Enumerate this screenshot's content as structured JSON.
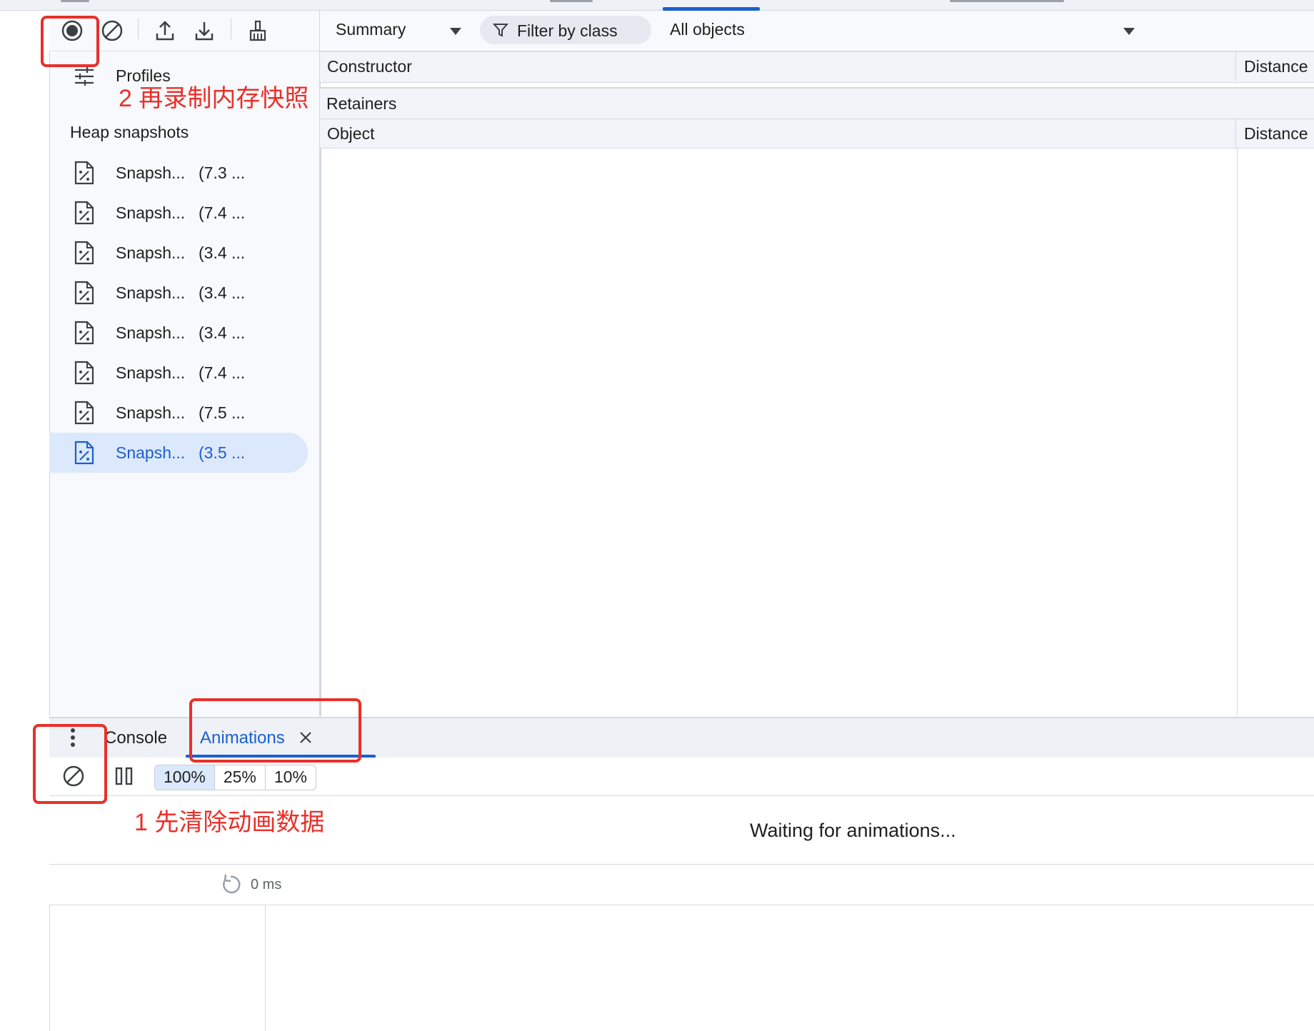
{
  "left_toolbar": {
    "record_icon": "record-icon",
    "clear_icon": "clear-icon",
    "load_icon": "upload-icon",
    "save_icon": "download-icon",
    "gc_icon": "broom-icon"
  },
  "sidebar": {
    "profiles_label": "Profiles",
    "heap_snapshots_title": "Heap snapshots",
    "snapshots": [
      {
        "name": "Snapsh...",
        "size": "(7.3 ..."
      },
      {
        "name": "Snapsh...",
        "size": "(7.4 ..."
      },
      {
        "name": "Snapsh...",
        "size": "(3.4 ..."
      },
      {
        "name": "Snapsh...",
        "size": "(3.4 ..."
      },
      {
        "name": "Snapsh...",
        "size": "(3.4 ..."
      },
      {
        "name": "Snapsh...",
        "size": "(7.4 ..."
      },
      {
        "name": "Snapsh...",
        "size": "(7.5 ..."
      },
      {
        "name": "Snapsh...",
        "size": "(3.5 ...",
        "selected": true
      }
    ]
  },
  "main_toolbar": {
    "view_select": "Summary",
    "filter_placeholder": "Filter by class",
    "objects_select": "All objects"
  },
  "constructor_grid": {
    "col_constructor": "Constructor",
    "col_distance": "Distance"
  },
  "retainers": {
    "title": "Retainers",
    "col_object": "Object",
    "col_distance": "Distance"
  },
  "drawer": {
    "tabs": [
      {
        "label": "Console"
      },
      {
        "label": "Animations",
        "active": true
      }
    ],
    "speeds": [
      "100%",
      "25%",
      "10%"
    ],
    "active_speed": "100%",
    "waiting_text": "Waiting for animations...",
    "timeline_start": "0 ms"
  },
  "annotations": {
    "step2": "2 再录制内存快照",
    "step1": "1 先清除动画数据"
  },
  "colors": {
    "accent": "#1a5fd0",
    "annotation": "#e8302a",
    "selected_bg": "#dce8fb"
  }
}
